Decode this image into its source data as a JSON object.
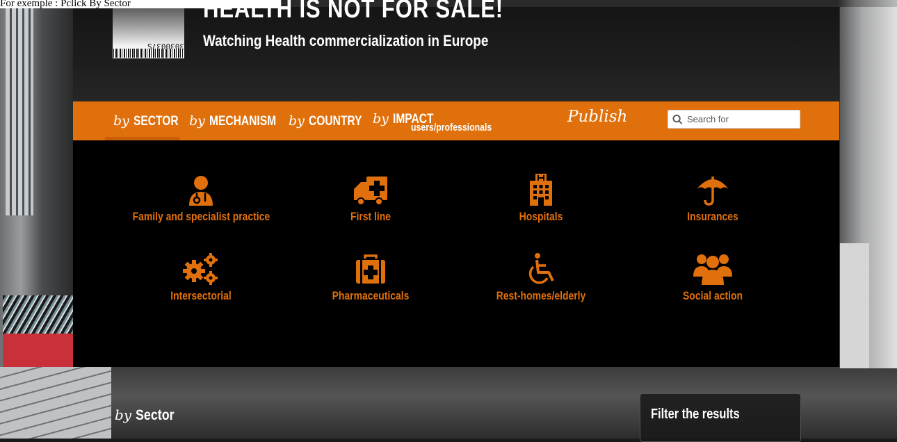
{
  "topline": "For exemple : Pclick By Sector",
  "header": {
    "title": "HEALTH IS NOT FOR SALE!",
    "subtitle": "Watching Health commercialization in Europe",
    "logo_code": "3030037S"
  },
  "nav": {
    "items": [
      {
        "by": "by",
        "label": "SECTOR",
        "active": true
      },
      {
        "by": "by",
        "label": "MECHANISM"
      },
      {
        "by": "by",
        "label": "COUNTRY"
      },
      {
        "by": "by",
        "label": "IMPACT",
        "sub": "users/professionals"
      }
    ],
    "publish": "Publish",
    "search": {
      "placeholder": "Search for"
    }
  },
  "sectors": [
    {
      "label": "Family and specialist practice",
      "icon": "doctor-icon"
    },
    {
      "label": "First line",
      "icon": "ambulance-icon"
    },
    {
      "label": "Hospitals",
      "icon": "hospital-icon"
    },
    {
      "label": "Insurances",
      "icon": "umbrella-icon"
    },
    {
      "label": "Intersectorial",
      "icon": "gears-icon"
    },
    {
      "label": "Pharmaceuticals",
      "icon": "medkit-icon"
    },
    {
      "label": "Rest-homes/elderly",
      "icon": "wheelchair-icon"
    },
    {
      "label": "Social action",
      "icon": "group-icon"
    }
  ],
  "section": {
    "by": "by",
    "label": "Sector"
  },
  "filter": {
    "title": "Filter the results"
  },
  "colors": {
    "accent": "#e0700c",
    "panel": "#000000"
  }
}
